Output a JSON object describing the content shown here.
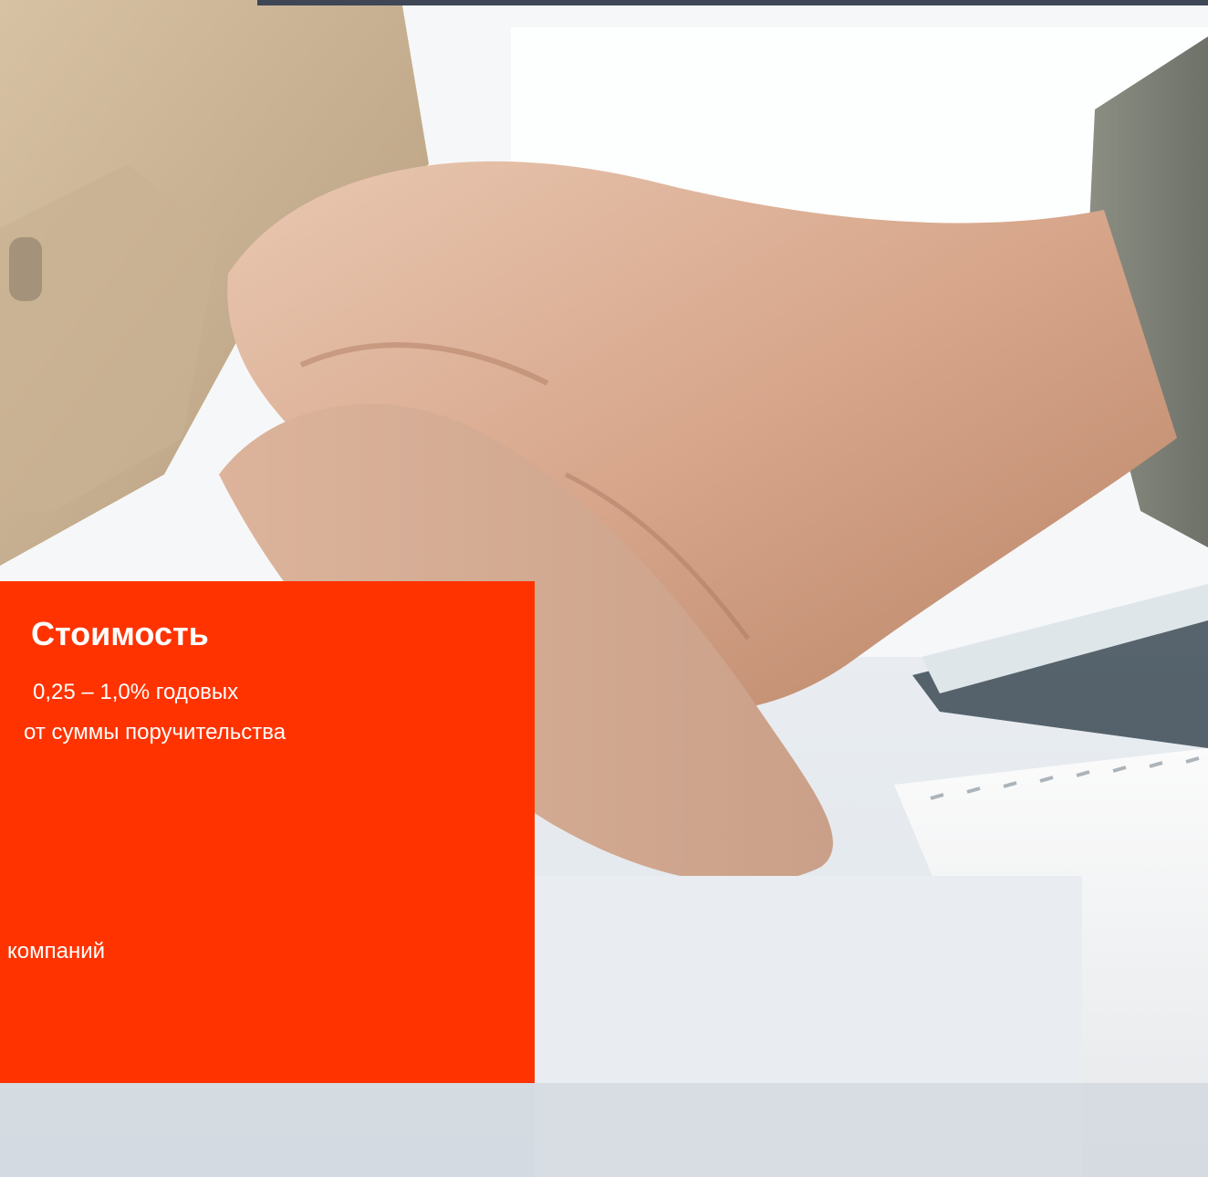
{
  "slide": {
    "cost_title": "Стоимость",
    "cost_rate": "0,25 – 1,0% годовых",
    "cost_base": "от суммы поручительства",
    "cut_text": "компаний"
  },
  "colors": {
    "accent": "#ff3300",
    "top_bar": "#3f4757"
  },
  "background_image": "handshake-photo"
}
